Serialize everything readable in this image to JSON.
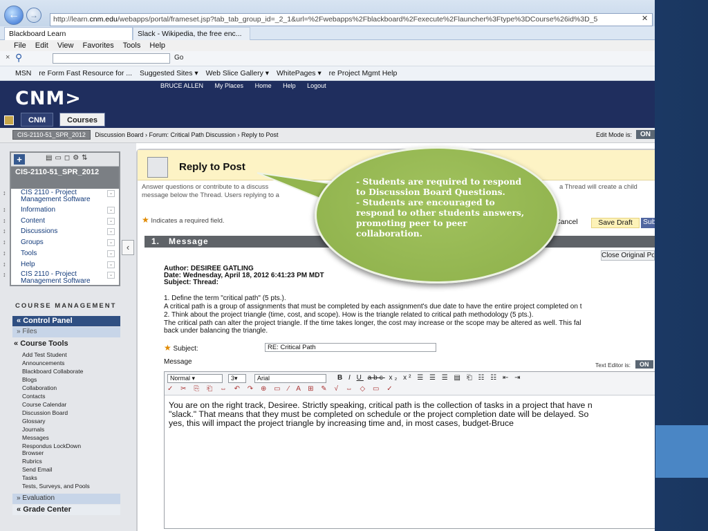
{
  "browser": {
    "url_prefix": "http://learn.",
    "url_domain": "cnm.edu",
    "url_rest": "/webapps/portal/frameset.jsp?tab_tab_group_id=_2_1&url=%2Fwebapps%2Fblackboard%2Fexecute%2Flauncher%3Ftype%3DCourse%26id%3D_5",
    "tabs": [
      "Blackboard Learn",
      "Slack - Wikipedia, the free enc..."
    ],
    "menu": [
      "File",
      "Edit",
      "View",
      "Favorites",
      "Tools",
      "Help"
    ],
    "search_go": "Go",
    "favorites": [
      "MSN",
      "re Form Fast Resource for ...",
      "Suggested Sites ▾",
      "Web Slice Gallery ▾",
      "WhitePages ▾",
      "re Project Mgmt Help"
    ]
  },
  "bb_header": {
    "logo": "CNM>",
    "top_links": [
      "BRUCE ALLEN",
      "My Places",
      "Home",
      "Help",
      "Logout"
    ],
    "tabs": [
      "CNM",
      "Courses"
    ]
  },
  "breadcrumb": {
    "course": "CIS-2110-51_SPR_2012",
    "path": "Discussion Board › Forum: Critical Path Discussion › Reply to Post",
    "edit_mode_label": "Edit Mode is:",
    "edit_mode_value": "ON"
  },
  "course_menu": {
    "title": "CIS-2110-51_SPR_2012",
    "items": [
      "CIS 2110 - Project Management Software",
      "Information",
      "Content",
      "Discussions",
      "Groups",
      "Tools",
      "Help",
      "CIS 2110 - Project Management Software"
    ]
  },
  "course_management": {
    "title": "COURSE MANAGEMENT",
    "control_panel": "Control Panel",
    "files": "Files",
    "course_tools": "Course Tools",
    "tools": [
      "Add Test Student",
      "Announcements",
      "Blackboard Collaborate",
      "Blogs",
      "Collaboration",
      "Contacts",
      "Course Calendar",
      "Discussion Board",
      "Glossary",
      "Journals",
      "Messages",
      "Respondus LockDown Browser",
      "Rubrics",
      "Send Email",
      "Tasks",
      "Tests, Surveys, and Pools"
    ],
    "evaluation": "Evaluation",
    "grade_center": "Grade Center"
  },
  "post": {
    "title": "Reply to Post",
    "instructions_a": "Answer questions or contribute to a discuss",
    "instructions_b": "message below the Thread. Users replying to a",
    "instructions_c": "a Thread will create a child",
    "required_note": "Indicates a required field.",
    "cancel": "Cancel",
    "save_draft": "Save Draft",
    "submit": "Submit",
    "section_number": "1.",
    "section_title": "Message",
    "close_original": "Close Original Post",
    "author": "Author: DESIREE GATLING",
    "date": "Date: Wednesday, April 18, 2012 6:41:23 PM MDT",
    "subject_line": "Subject: Thread:",
    "body": [
      "1. Define the term \"critical path\" (5 pts.).",
      "A critical path is a group of assignments that must be completed by each assignment's due date to have the entire project completed on t",
      "2. Think about the project triangle (time, cost, and scope). How is the triangle related to critical path methodology (5 pts.).",
      "The critical path can alter the project triangle. If the time takes longer, the cost may increase or the scope may be altered as well. This fal",
      "back under balancing the triangle."
    ],
    "subject_label": "Subject:",
    "subject_value": "RE: Critical Path",
    "message_label": "Message",
    "text_editor_label": "Text Editor is:",
    "text_editor_value": "ON",
    "format_value": "Normal",
    "size_value": "3",
    "font_value": "Arial",
    "reply_lines": [
      "You are on the right track, Desiree. Strictly speaking, critical path is the collection of tasks in a project that have n",
      "\"slack.\"   That means that they must be completed on schedule or the project completion date will be delayed. So",
      "yes, this will impact the project triangle by increasing time and, in most cases, budget-Bruce"
    ]
  },
  "callout": {
    "lines": [
      "-  Students are required to respond to Discussion Board Questions.",
      "-  Students are encouraged to respond to other students answers, promoting peer to peer collaboration."
    ]
  },
  "colors": {
    "bb_header": "#1f2e5e",
    "callout": "#95b651",
    "slide_bg": "#1d3c6a",
    "accent": "#4a86c5"
  }
}
